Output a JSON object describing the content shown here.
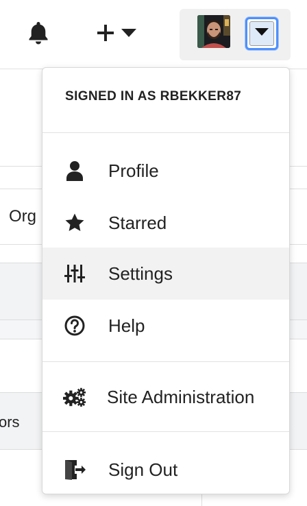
{
  "header": {
    "icons": {
      "notifications": "bell-icon",
      "create": "plus-icon",
      "caret": "caret-down-icon"
    },
    "avatar_alt": "user avatar"
  },
  "background": {
    "org_fragment": "Org",
    "ors_fragment": "ors"
  },
  "user_menu": {
    "header": "SIGNED IN AS RBEKKER87",
    "items": [
      {
        "label": "Profile",
        "icon": "user-icon"
      },
      {
        "label": "Starred",
        "icon": "star-icon"
      },
      {
        "label": "Settings",
        "icon": "sliders-icon",
        "active": true
      },
      {
        "label": "Help",
        "icon": "question-circle-icon"
      },
      {
        "label": "Site Administration",
        "icon": "gears-icon"
      },
      {
        "label": "Sign Out",
        "icon": "sign-out-icon"
      }
    ]
  },
  "colors": {
    "focus_ring": "#4d90fe",
    "active_row": "#f2f2f2",
    "text": "#222222"
  }
}
